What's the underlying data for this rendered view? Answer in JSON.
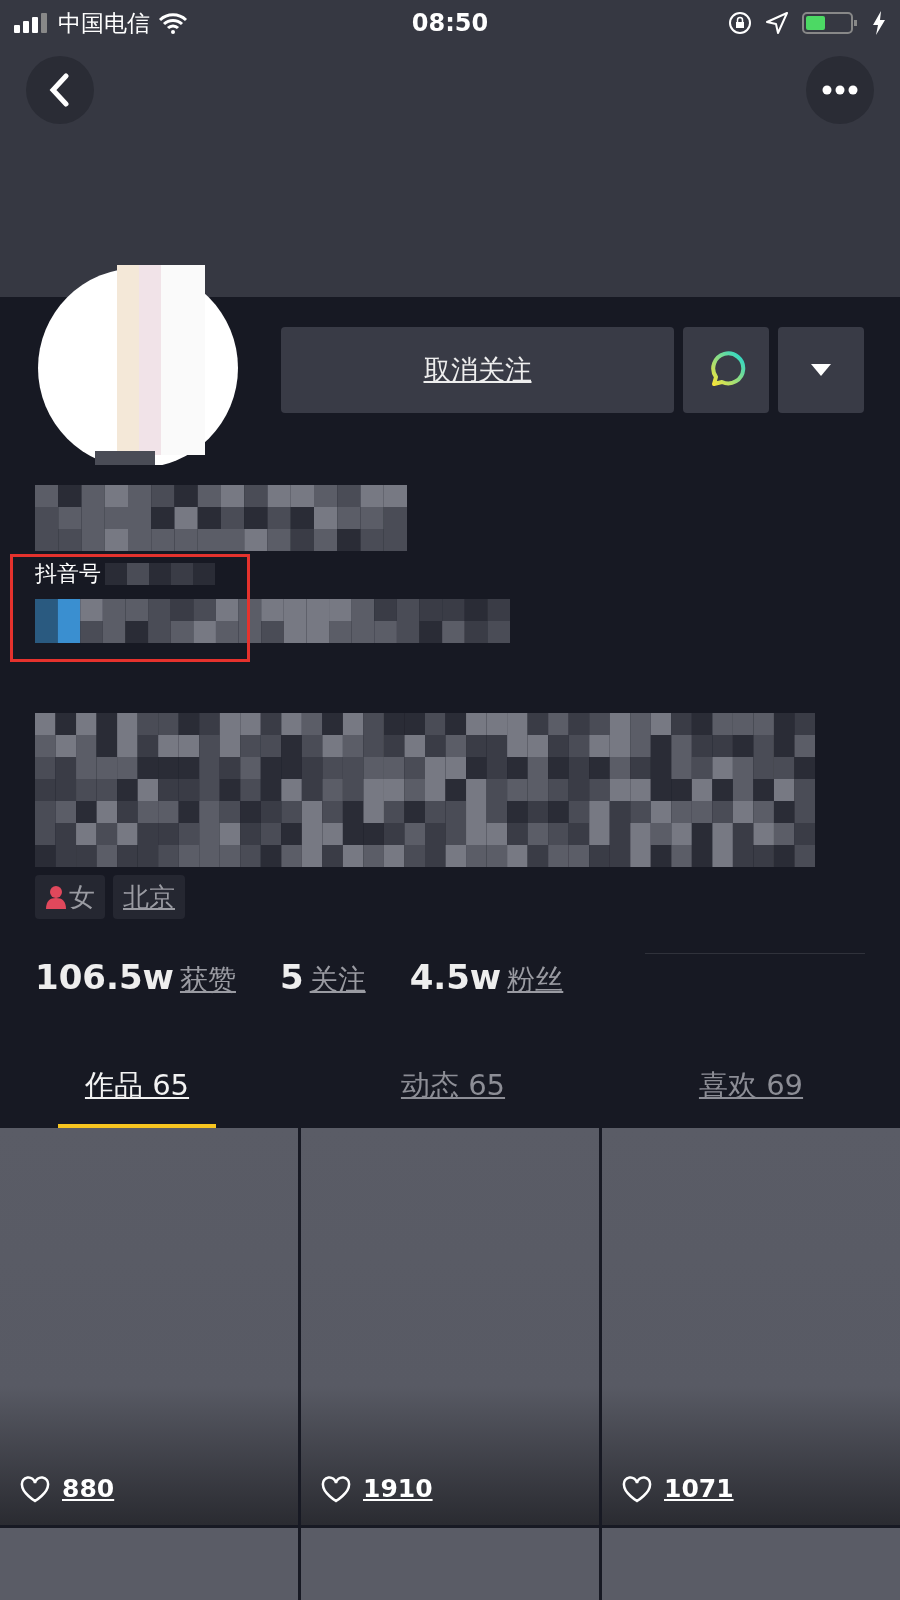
{
  "status_bar": {
    "carrier": "中国电信",
    "time": "08:50"
  },
  "profile": {
    "follow_button": "取消关注",
    "id_label": "抖音号"
  },
  "tags": [
    {
      "kind": "gender",
      "label": "女",
      "color": "#e0485c"
    },
    {
      "kind": "location",
      "label": "北京"
    }
  ],
  "stats": [
    {
      "count": "106.5w",
      "name": "获赞"
    },
    {
      "count": "5",
      "name": "关注"
    },
    {
      "count": "4.5w",
      "name": "粉丝"
    }
  ],
  "tabs": [
    {
      "label": "作品 65",
      "selected": true
    },
    {
      "label": "动态 65",
      "selected": false
    },
    {
      "label": "喜欢 69",
      "selected": false
    }
  ],
  "videos": [
    {
      "kind": "full",
      "likes": "880"
    },
    {
      "kind": "full",
      "likes": "1910"
    },
    {
      "kind": "full",
      "likes": "1071"
    },
    {
      "kind": "partial"
    },
    {
      "kind": "partial"
    },
    {
      "kind": "partial"
    }
  ]
}
